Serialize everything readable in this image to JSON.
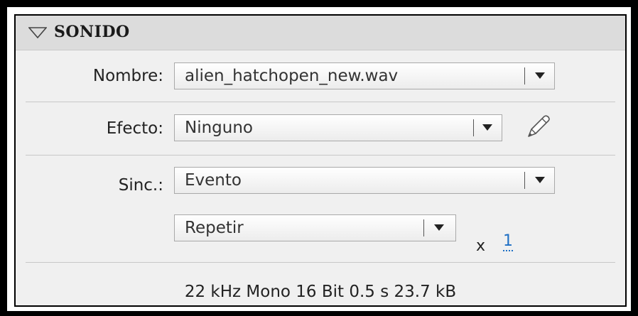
{
  "section": {
    "title": "SONIDO"
  },
  "name_field": {
    "label": "Nombre:",
    "value": "alien_hatchopen_new.wav"
  },
  "effect_field": {
    "label": "Efecto:",
    "value": "Ninguno"
  },
  "sync_field": {
    "label": "Sinc.:",
    "value": "Evento"
  },
  "repeat_field": {
    "value": "Repetir",
    "times_label": "x",
    "count": "1"
  },
  "sound_info": "22 kHz Mono 16 Bit 0.5 s 23.7 kB",
  "icons": {
    "collapse": "triangle-down-icon",
    "edit": "pencil-icon",
    "dropdown": "chevron-down-icon"
  }
}
